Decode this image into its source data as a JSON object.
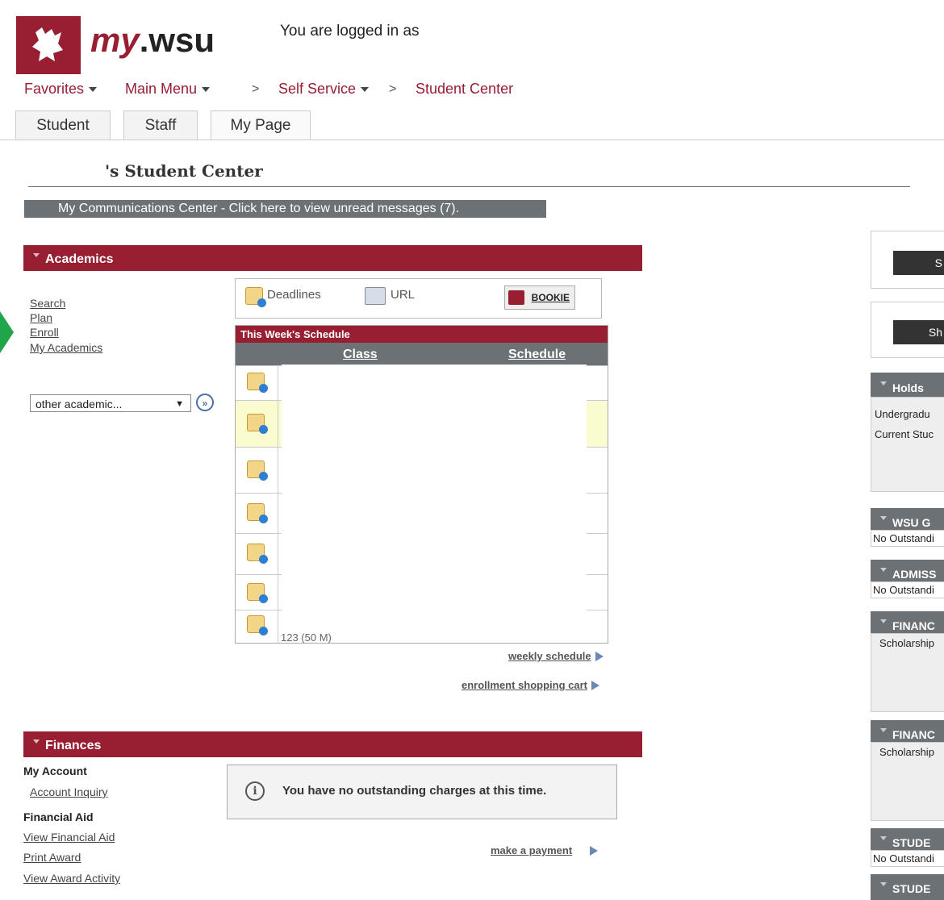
{
  "header": {
    "logo_my": "my",
    "logo_wsu": ".wsu",
    "logged_in_text": "You are logged in as"
  },
  "nav": {
    "favorites": "Favorites",
    "main_menu": "Main Menu",
    "self_service": "Self Service",
    "student_center": "Student Center",
    "sep": ">"
  },
  "tabs": [
    "Student",
    "Staff",
    "My Page"
  ],
  "page_title": "'s Student Center",
  "comm_center": "My Communications Center - Click here to view unread messages (7).",
  "academics": {
    "title": "Academics",
    "links": [
      "Search",
      "Plan",
      "Enroll",
      "My Academics"
    ],
    "select_value": "other academic...",
    "toolbar": {
      "deadlines": "Deadlines",
      "url": "URL",
      "bookie": "BOOKIE"
    },
    "schedule": {
      "title": "This Week's Schedule",
      "col_class": "Class",
      "col_schedule": "Schedule",
      "footer_partial": "123 (50 M)"
    },
    "weekly_schedule": "weekly schedule",
    "shopping_cart": "enrollment shopping cart"
  },
  "finances": {
    "title": "Finances",
    "my_account": "My Account",
    "account_inquiry": "Account Inquiry",
    "financial_aid": "Financial Aid",
    "view_fin_aid": "View Financial Aid",
    "print_award": "Print Award",
    "view_award_activity": "View Award Activity",
    "message": "You have no outstanding charges at this time.",
    "make_payment": "make a payment"
  },
  "right": {
    "btn1": "S",
    "btn2": "Sh",
    "holds": "Holds",
    "holds_line1": "Undergradu",
    "holds_line2": "Current Stuc",
    "wsu_g": "WSU G",
    "no_outstand": "No Outstandi",
    "admiss": "ADMISS",
    "finan": "FINANC",
    "scholarship": "Scholarship",
    "stude": "STUDE"
  },
  "colors": {
    "crimson": "#981e32",
    "gray_bar": "#6b7175",
    "green": "#1fa64a"
  }
}
